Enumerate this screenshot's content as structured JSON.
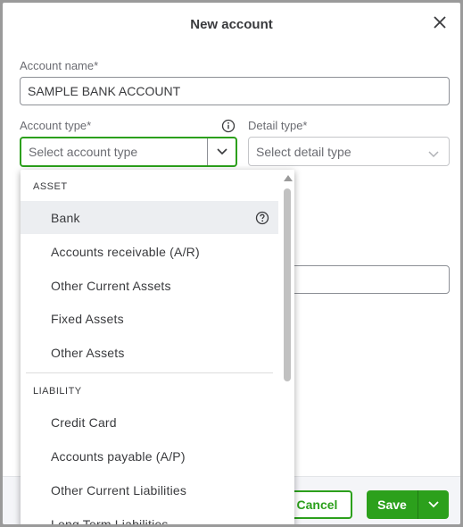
{
  "dialog": {
    "title": "New account"
  },
  "account_name": {
    "label": "Account name*",
    "value": "SAMPLE BANK ACCOUNT"
  },
  "account_type": {
    "label": "Account type*",
    "placeholder": "Select account type"
  },
  "detail_type": {
    "label": "Detail type*",
    "placeholder": "Select detail type"
  },
  "dropdown": {
    "sections": [
      {
        "header": "ASSET",
        "options": [
          "Bank",
          "Accounts receivable (A/R)",
          "Other Current Assets",
          "Fixed Assets",
          "Other Assets"
        ]
      },
      {
        "header": "LIABILITY",
        "options": [
          "Credit Card",
          "Accounts payable (A/P)",
          "Other Current Liabilities",
          "Long Term Liabilities"
        ]
      }
    ],
    "hovered_option": "Bank"
  },
  "footer": {
    "cancel_label": "Cancel",
    "save_label": "Save"
  },
  "colors": {
    "accent": "#2ca01c",
    "focus_border": "#2ca01c",
    "hover_bg": "#eceef1"
  },
  "icons": [
    "close-icon",
    "info-icon",
    "chevron-down-icon",
    "help-icon"
  ]
}
